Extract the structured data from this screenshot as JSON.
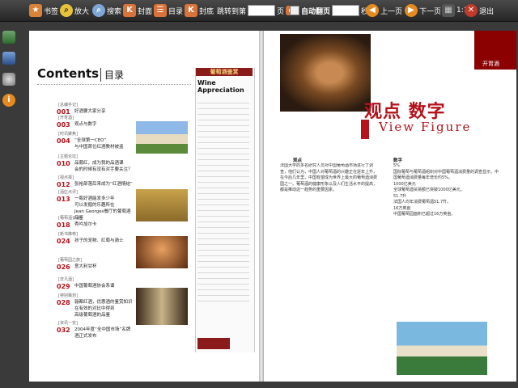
{
  "toolbar": {
    "bookmark": "书签",
    "zoom": "放大",
    "search": "搜索",
    "cover": "封面",
    "toc": "目录",
    "back_cover": "封底",
    "goto_prefix": "跳转到第",
    "goto_value": "",
    "goto_suffix": "页",
    "auto_flip": "自动翻页",
    "auto_seconds": "",
    "seconds_unit": "秒",
    "prev": "上一页",
    "next": "下一页",
    "ratio": "1:1",
    "exit": "退出"
  },
  "left": {
    "heading": "Contents",
    "heading_cn": "目录",
    "masthead": {
      "logo_cn": "葡萄酒鉴赏",
      "logo_en": "Wine Appreciation"
    },
    "toc": [
      {
        "num": "001",
        "title": "好酒要大家分享",
        "section": "[总编手记]"
      },
      {
        "num": "003",
        "title": "观点与数字",
        "section": "[开胃酒]"
      },
      {
        "num": "004",
        "title": "“全球第一CEO”\n与中国首位红酒教材被盗",
        "section": "[时讯聚焦]"
      },
      {
        "num": "010",
        "title": "品葡红，成为我的品酒课\n会的时候有没有对手要关注？",
        "section": "[主题论坛]"
      },
      {
        "num": "012",
        "title": "张裕部落后来成为“红酒情结”",
        "section": "[视点报]"
      },
      {
        "num": "013",
        "title": "一瓶好酒能发多少年\n可以发掘的乐趣所在\nJean Georges餐厅的葡萄酒品鉴",
        "section": "[酒庄点评]"
      },
      {
        "num": "018",
        "title": "秀吟加尔卡",
        "section": "[葡萄酒访谈]"
      },
      {
        "num": "024",
        "title": "孩子的宠物、红萄与骑士",
        "section": "[新书推荐]"
      },
      {
        "num": "026",
        "title": "意大利甘杯",
        "section": "[葡萄园之旅]"
      },
      {
        "num": "029",
        "title": "中国葡萄酒协会系谱",
        "section": "[非凡酒]"
      },
      {
        "num": "028",
        "title": "骊都红酒，优惠酒的鉴赏知识\n在有效的对比中得到\n高级葡萄酒的品鉴",
        "section": "[特别策划]"
      },
      {
        "num": "032",
        "title": "2004年度“全中国市场”名牌酒正式发布",
        "section": "[资讯一览]"
      }
    ]
  },
  "right": {
    "tab": "开胃酒",
    "title_cn": "观点 数字",
    "title_en": "View Figure",
    "col1_head": "观点",
    "col1_text": "法国大学的多名研究人员对中国葡萄酒市场进行了调查，他们认为，中国人对葡萄酒的兴趣正在逐年上升，在今后几年里，中国有望成为世界上最大的葡萄酒消费国之一。葡萄酒的健康形象以及人们生活水平的提高，都是推动这一趋势的重要因素。",
    "col2_head": "数字",
    "col2_text": "5%\n国际葡萄与葡萄酒组织对中国葡萄酒消费量的调查显示，中国葡萄酒消费量每年增长约5%。\n1000亿美元\n全球葡萄酒贸易额已突破1000亿美元。\n51.7升\n法国人均年消费葡萄酒51.7升。\n16万英亩\n中国葡萄园面积已超过16万英亩。"
  }
}
